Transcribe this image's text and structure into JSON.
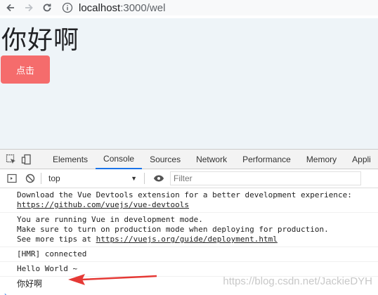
{
  "browser": {
    "url_host": "localhost",
    "url_path": ":3000/wel"
  },
  "page": {
    "heading": "你好啊",
    "button_label": "点击"
  },
  "devtools": {
    "tabs": [
      {
        "label": "Elements"
      },
      {
        "label": "Console"
      },
      {
        "label": "Sources"
      },
      {
        "label": "Network"
      },
      {
        "label": "Performance"
      },
      {
        "label": "Memory"
      },
      {
        "label": "Appli"
      }
    ],
    "active_tab": "Console",
    "context": "top",
    "filter_placeholder": "Filter"
  },
  "console": {
    "msg1_line1": "Download the Vue Devtools extension for a better development experience:",
    "msg1_link": "https://github.com/vuejs/vue-devtools",
    "msg2_line1": "You are running Vue in development mode.",
    "msg2_line2": "Make sure to turn on production mode when deploying for production.",
    "msg2_line3_prefix": "See more tips at ",
    "msg2_link": "https://vuejs.org/guide/deployment.html",
    "msg3": "[HMR] connected",
    "msg4": "Hello World ~",
    "msg5": "你好啊",
    "prompt": "›"
  },
  "watermark": "https://blog.csdn.net/JackieDYH",
  "colors": {
    "button_bg": "#f56c6c",
    "viewport_bg": "#eef4f8",
    "active_tab_underline": "#1a73e8",
    "arrow": "#e53935"
  }
}
